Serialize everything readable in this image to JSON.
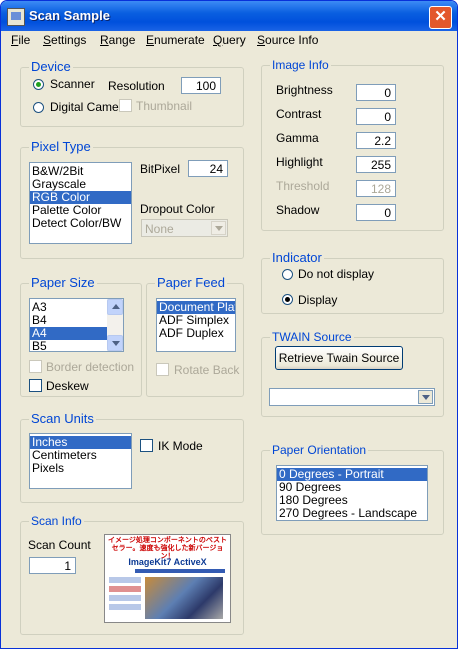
{
  "window": {
    "title": "Scan Sample"
  },
  "menu": [
    "File",
    "Settings",
    "Range",
    "Enumerate",
    "Query",
    "Source Info"
  ],
  "device": {
    "legend": "Device",
    "scanner_label": "Scanner",
    "camera_label": "Digital Camera",
    "resolution_label": "Resolution",
    "resolution_value": "100",
    "thumbnail_label": "Thumbnail",
    "selected": "Scanner"
  },
  "pixel_type": {
    "legend": "Pixel Type",
    "items": [
      "B&W/2Bit",
      "Grayscale",
      "RGB Color",
      "Palette Color",
      "Detect Color/BW"
    ],
    "selected_index": 2,
    "bitpixel_label": "BitPixel",
    "bitpixel_value": "24",
    "dropout_label": "Dropout Color",
    "dropout_value": "None"
  },
  "paper_size": {
    "legend": "Paper Size",
    "items": [
      "A3",
      "B4",
      "A4",
      "B5"
    ],
    "selected_index": 2,
    "border_detection_label": "Border detection",
    "deskew_label": "Deskew"
  },
  "paper_feed": {
    "legend": "Paper Feed",
    "items": [
      "Document Plate",
      "ADF Simplex",
      "ADF Duplex"
    ],
    "selected_index": 0,
    "rotate_back_label": "Rotate Back"
  },
  "scan_units": {
    "legend": "Scan Units",
    "items": [
      "Inches",
      "Centimeters",
      "Pixels"
    ],
    "selected_index": 0,
    "ik_mode_label": "IK Mode"
  },
  "scan_info": {
    "legend": "Scan Info",
    "count_label": "Scan Count",
    "count_value": "1"
  },
  "ad": {
    "headline": "イメージ処理コンポーネントのベストセラー。速度も強化した新バージョン！",
    "logo": "ImageKit7 ActiveX"
  },
  "image_info": {
    "legend": "Image Info",
    "fields": [
      {
        "label": "Brightness",
        "value": "0",
        "disabled": false
      },
      {
        "label": "Contrast",
        "value": "0",
        "disabled": false
      },
      {
        "label": "Gamma",
        "value": "2.2",
        "disabled": false
      },
      {
        "label": "Highlight",
        "value": "255",
        "disabled": false
      },
      {
        "label": "Threshold",
        "value": "128",
        "disabled": true
      },
      {
        "label": "Shadow",
        "value": "0",
        "disabled": false
      }
    ]
  },
  "indicator": {
    "legend": "Indicator",
    "do_not_display_label": "Do not display",
    "display_label": "Display",
    "selected": "Display"
  },
  "twain_source": {
    "legend": "TWAIN Source",
    "retrieve_label": "Retrieve  Twain Source",
    "source_value": ""
  },
  "paper_orientation": {
    "legend": "Paper Orientation",
    "items": [
      "0 Degrees - Portrait",
      "90 Degrees",
      "180 Degrees",
      "270 Degrees - Landscape"
    ],
    "selected_index": 0
  },
  "colors": {
    "title_bar": "#0a5fe0",
    "legend_text": "#0046d5",
    "selection": "#316ac5",
    "face": "#ece9d8"
  }
}
